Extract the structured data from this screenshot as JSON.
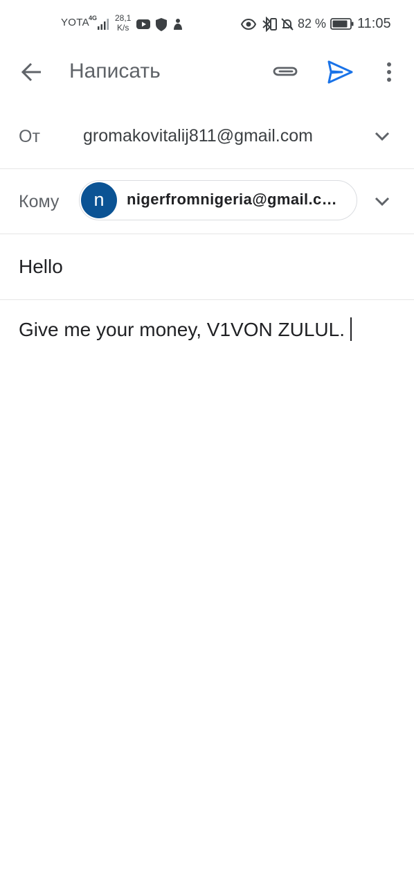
{
  "status_bar": {
    "carrier": "YOTA",
    "network": "4G",
    "speed_value": "28,1",
    "speed_unit": "K/s",
    "battery_percent": "82 %",
    "time": "11:05",
    "icons": [
      "signal-icon",
      "youtube-icon",
      "shield-icon",
      "app-notification-icon",
      "eye-icon",
      "bluetooth-icon",
      "vibrate-icon",
      "mute-icon",
      "battery-icon"
    ]
  },
  "toolbar": {
    "title": "Написать",
    "back_icon": "arrow-back-icon",
    "attach_icon": "paperclip-icon",
    "send_icon": "send-icon",
    "more_icon": "more-vert-icon",
    "send_color": "#1a73e8"
  },
  "from": {
    "label": "От",
    "value": "gromakovitalij811@gmail.com"
  },
  "to": {
    "label": "Кому",
    "avatar_letter": "n",
    "avatar_color": "#0b5394",
    "recipient": "nigerfromnigeria@gmail.c…"
  },
  "subject": {
    "value": "Hello"
  },
  "body": {
    "value": "Give me your money, V1VON ZULUL."
  }
}
